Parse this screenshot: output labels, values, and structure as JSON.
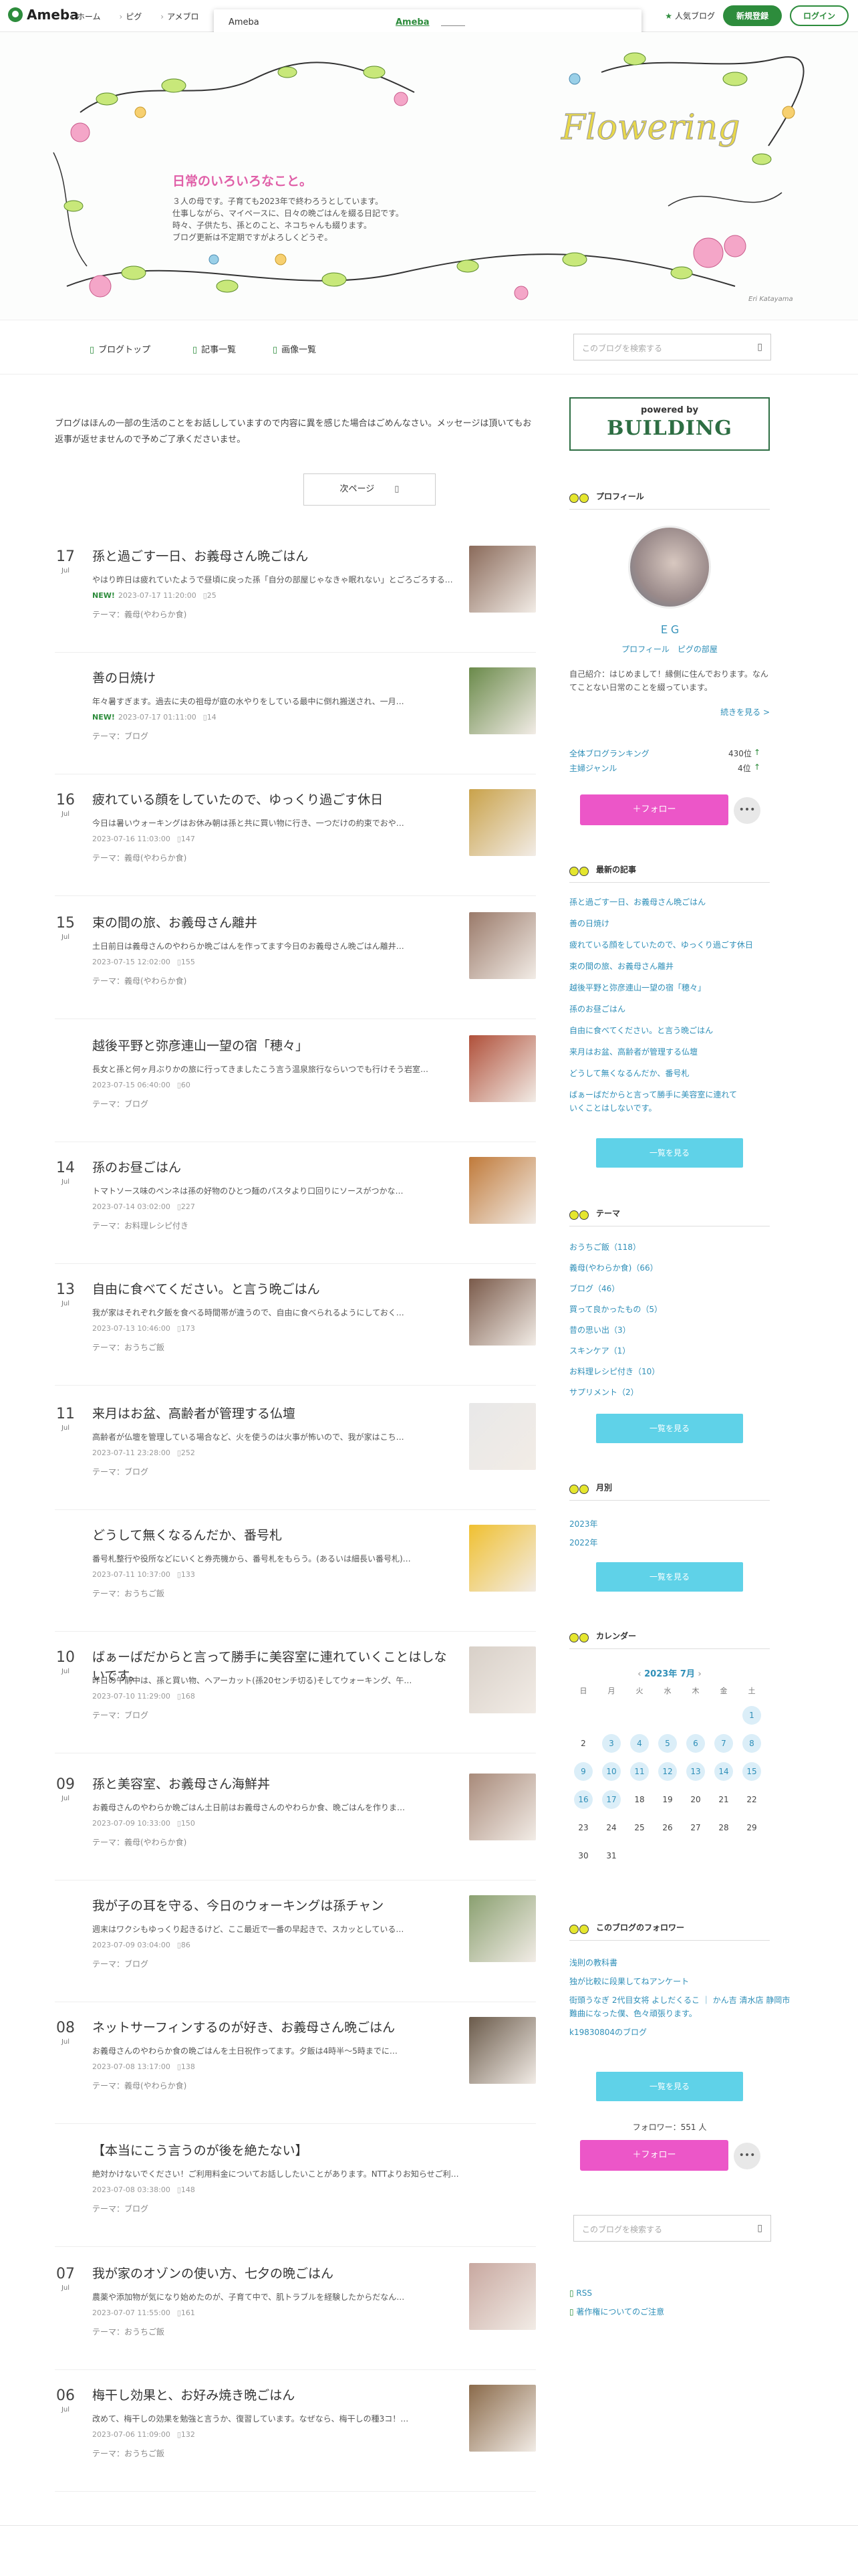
{
  "topbar": {
    "logo": "Ameba",
    "nav": [
      "ホーム",
      "ピグ",
      "アメブロ"
    ],
    "popup_label": "Ameba",
    "popup_link": "Ameba",
    "popup_close": "× ☰",
    "popular_blog": "人気ブログ",
    "register": "新規登録",
    "login": "ログイン"
  },
  "header": {
    "title": "日常のいろいろなこと。",
    "desc": [
      "３人の母です。子育ても2023年で終わろうとしています。",
      "仕事しながら、マイペースに、日々の晩ごはんを綴る日記です。",
      "時々、子供たち、孫とのこと、ネコちゃんも綴ります。",
      "ブログ更新は不定期ですがよろしくどうぞ。"
    ],
    "deco_text": "Flowering",
    "artist": "Eri Katayama"
  },
  "subnav": {
    "items": [
      "ブログトップ",
      "記事一覧",
      "画像一覧"
    ],
    "search_placeholder": "このブログを検索する",
    "search_icon": "search-icon"
  },
  "main": {
    "notice": "ブログはほんの一部の生活のことをお話ししていますので内容に異を感じた場合はごめんなさい。メッセージは頂いてもお返事が返せませんので予めご了承くださいませ。",
    "next_page": "次ページ",
    "posts": [
      {
        "day": "17",
        "mon": "Jul",
        "title": "孫と過ごす一日、お義母さん晩ごはん",
        "excerpt": "やはり昨日は疲れていたようで昼頃に戻った孫「自分の部屋じゃなきゃ眠れない」とごろごろする孫を見に行…",
        "new": "NEW!",
        "date": "2023-07-17 11:20:00",
        "comments": "25",
        "theme": "テーマ：義母(やわらか食)",
        "color": "#8a6a5a"
      },
      {
        "day": "",
        "mon": "",
        "title": "善の日焼け",
        "excerpt": "年々暑すぎます。過去に夫の祖母が庭の水やりをしている最中に倒れ搬送され、一月…",
        "new": "NEW!",
        "date": "2023-07-17 01:11:00",
        "comments": "14",
        "theme": "テーマ：ブログ",
        "color": "#6a8a4a"
      },
      {
        "day": "16",
        "mon": "Jul",
        "title": "疲れている顔をしていたので、ゆっくり過ごす休日",
        "excerpt": "今日は暑いウォーキングはお休み朝は孫と共に買い物に行き、一つだけの約束でおや…",
        "new": "",
        "date": "2023-07-16 11:03:00",
        "comments": "147",
        "theme": "テーマ：義母(やわらか食)",
        "color": "#c9a24a"
      },
      {
        "day": "15",
        "mon": "Jul",
        "title": "束の間の旅、お義母さん離井",
        "excerpt": "土日前日は義母さんのやわらか晩ごはんを作ってます今日のお義母さん晩ごはん離井…",
        "new": "",
        "date": "2023-07-15 12:02:00",
        "comments": "155",
        "theme": "テーマ：義母(やわらか食)",
        "color": "#9a7a6a"
      },
      {
        "day": "",
        "mon": "",
        "title": "越後平野と弥彦連山一望の宿「穂々」",
        "excerpt": "長女と孫と何ヶ月ぶりかの旅に行ってきましたこう言う温泉旅行ならいつでも行けそう岩室…",
        "new": "",
        "date": "2023-07-15 06:40:00",
        "comments": "60",
        "theme": "テーマ：ブログ",
        "color": "#b0503a"
      },
      {
        "day": "14",
        "mon": "Jul",
        "title": "孫のお昼ごはん",
        "excerpt": "トマトソース味のペンネは孫の好物のひとつ麺のパスタより口回りにソースがつかな…",
        "new": "",
        "date": "2023-07-14 03:02:00",
        "comments": "227",
        "theme": "テーマ：お料理レシピ付き",
        "color": "#c07a3a"
      },
      {
        "day": "13",
        "mon": "Jul",
        "title": "自由に食べてください。と言う晩ごはん",
        "excerpt": "我が家はそれぞれ夕飯を食べる時間帯が違うので、自由に食べられるようにしておく…",
        "new": "",
        "date": "2023-07-13 10:46:00",
        "comments": "173",
        "theme": "テーマ：おうちご飯",
        "color": "#7a5a4a"
      },
      {
        "day": "11",
        "mon": "Jul",
        "title": "来月はお盆、高齢者が管理する仏壇",
        "excerpt": "高齢者が仏壇を管理している場合など、火を使うのは火事が怖いので、我が家はこち…",
        "new": "",
        "date": "2023-07-11 23:28:00",
        "comments": "252",
        "theme": "テーマ：ブログ",
        "color": "#e8e8e8"
      },
      {
        "day": "",
        "mon": "",
        "title": "どうして無くなるんだか、番号札",
        "excerpt": "番号札整行や役所などにいくと券売機から、番号札をもらう。(あるいは細長い番号札)…",
        "new": "",
        "date": "2023-07-11 10:37:00",
        "comments": "133",
        "theme": "テーマ：おうちご飯",
        "color": "#f0c030"
      },
      {
        "day": "10",
        "mon": "Jul",
        "title": "ばぁーばだからと言って勝手に美容室に連れていくことはしないです。",
        "excerpt": "昨日の午前中は、孫と買い物、ヘアーカット(孫20センチ切る)そしてウォーキング、午…",
        "new": "",
        "date": "2023-07-10 11:29:00",
        "comments": "168",
        "theme": "テーマ：ブログ",
        "color": "#d8d0c8"
      },
      {
        "day": "09",
        "mon": "Jul",
        "title": "孫と美容室、お義母さん海鮮丼",
        "excerpt": "お義母さんのやわらか晩ごはん土日前はお義母さんのやわらか食、晩ごはんを作りま…",
        "new": "",
        "date": "2023-07-09 10:33:00",
        "comments": "150",
        "theme": "テーマ：義母(やわらか食)",
        "color": "#a88a7a"
      },
      {
        "day": "",
        "mon": "",
        "title": "我が子の耳を守る、今日のウォーキングは孫チャン",
        "excerpt": "週末はワクシもゆっくり起きるけど、ここ最近で一番の早起きで、スカッとしている…",
        "new": "",
        "date": "2023-07-09 03:04:00",
        "comments": "86",
        "theme": "テーマ：ブログ",
        "color": "#8aa070"
      },
      {
        "day": "08",
        "mon": "Jul",
        "title": "ネットサーフィンするのが好き、お義母さん晩ごはん",
        "excerpt": "お義母さんのやわらか食の晩ごはんを土日祝作ってます。夕飯は4時半～5時までに…",
        "new": "",
        "date": "2023-07-08 13:17:00",
        "comments": "138",
        "theme": "テーマ：義母(やわらか食)",
        "color": "#6a5a4a"
      },
      {
        "day": "",
        "mon": "",
        "title": "【本当にこう言うのが後を絶たない】",
        "excerpt": "絶対かけないでください！ご利用料金についてお話ししたいことがあります。NTTよりお知らせご利用…",
        "new": "",
        "date": "2023-07-08 03:38:00",
        "comments": "148",
        "theme": "テーマ：ブログ",
        "color": ""
      },
      {
        "day": "07",
        "mon": "Jul",
        "title": "我が家のオゾンの使い方、七夕の晩ごはん",
        "excerpt": "農薬や添加物が気になり始めたのが、子育て中で、肌トラブルを経験したからだなん…",
        "new": "",
        "date": "2023-07-07 11:55:00",
        "comments": "161",
        "theme": "テーマ：おうちご飯",
        "color": "#c8a8a0"
      },
      {
        "day": "06",
        "mon": "Jul",
        "title": "梅干し効果と、お好み焼き晩ごはん",
        "excerpt": "改めて、梅干しの効果を勉強と言うか、復習しています。なぜなら、梅干しの種3コ！…",
        "new": "",
        "date": "2023-07-06 11:09:00",
        "comments": "132",
        "theme": "テーマ：おうちご飯",
        "color": "#8a6a4a"
      }
    ]
  },
  "sidebar": {
    "building_small": "powered by",
    "building": "BUILDING",
    "profile_head": "プロフィール",
    "profile_name": "ＥＧ",
    "profile_links": [
      "プロフィール",
      "ピグの部屋"
    ],
    "profile_text": "自己紹介：はじめまして！縁側に住んでおります。なんてことない日常のことを綴っています。",
    "profile_more": "続きを見る >",
    "rank_all_label": "全体ブログランキング",
    "rank_all": "430位",
    "rank_genre_label": "主婦ジャンル",
    "rank_genre": "4位",
    "follow": "＋フォロー",
    "more": "•••",
    "recent_head": "最新の記事",
    "recent": [
      "孫と過ごす一日、お義母さん晩ごはん",
      "善の日焼け",
      "疲れている顔をしていたので、ゆっくり過ごす休日",
      "束の間の旅、お義母さん離井",
      "越後平野と弥彦連山一望の宿「穂々」",
      "孫のお昼ごはん",
      "自由に食べてください。と言う晩ごはん",
      "来月はお盆、高齢者が管理する仏壇",
      "どうして無くなるんだか、番号札",
      "ばぁーばだからと言って勝手に美容室に連れて",
      "いくことはしないです。"
    ],
    "list_btn": "一覧を見る",
    "theme_head": "テーマ",
    "themes": [
      "おうちご飯（118）",
      "義母(やわらか食)（66）",
      "ブログ（46）",
      "買って良かったもの（5）",
      "昔の思い出（3）",
      "スキンケア（1）",
      "お料理レシピ付き（10）",
      "サプリメント（2）"
    ],
    "month_head": "月別",
    "months": [
      "2023年",
      "2022年"
    ],
    "cal_head": "カレンダー",
    "cal_month": "2023年 7月",
    "cal_week": [
      "日",
      "月",
      "火",
      "水",
      "木",
      "金",
      "土"
    ],
    "cal_days": [
      "",
      "",
      "",
      "",
      "",
      "",
      "1",
      "2",
      "3",
      "4",
      "5",
      "6",
      "7",
      "8",
      "9",
      "10",
      "11",
      "12",
      "13",
      "14",
      "15",
      "16",
      "17",
      "18",
      "19",
      "20",
      "21",
      "22",
      "23",
      "24",
      "25",
      "26",
      "27",
      "28",
      "29",
      "30",
      "31",
      "",
      "",
      "",
      "",
      ""
    ],
    "cal_posted": [
      1,
      3,
      4,
      5,
      6,
      7,
      8,
      9,
      10,
      11,
      12,
      13,
      14,
      15,
      16,
      17
    ],
    "follow_head": "このブログのフォロワー",
    "followers_list": [
      "浅則の教科書",
      "独が比較に段果してねアンケート",
      "街頭うなぎ 2代目女将 よしだくるこ ｜ かん吉 清水店 静岡市",
      "難曲になった僕、色々頑張ります。",
      "k19830804のブログ"
    ],
    "followers": "フォロワー：551 人",
    "search_placeholder": "このブログを検索する",
    "rss": "RSS",
    "copyright": "著作権についてのご注意"
  }
}
